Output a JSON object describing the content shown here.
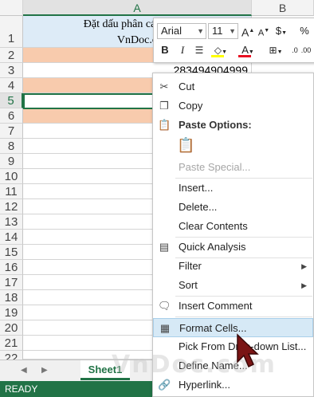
{
  "columns": {
    "a": "A",
    "b": "B"
  },
  "rows": [
    "1",
    "2",
    "3",
    "4",
    "5",
    "6",
    "7",
    "8",
    "9",
    "10",
    "11",
    "12",
    "13",
    "14",
    "15",
    "16",
    "17",
    "18",
    "19",
    "20",
    "21",
    "22"
  ],
  "cells": {
    "a1_line1": "Đặt dấu phân cách hàng",
    "a1_line2": "VnDoc.c",
    "a3_value": "283494904999"
  },
  "mini_toolbar": {
    "font_name": "Arial",
    "font_size": "11",
    "grow_font": "A",
    "shrink_font": "A",
    "currency": "$",
    "percent": "%",
    "bold": "B",
    "italic": "I",
    "font_color_letter": "A"
  },
  "context_menu": {
    "cut": "Cut",
    "copy": "Copy",
    "paste_options": "Paste Options:",
    "paste_special": "Paste Special...",
    "insert": "Insert...",
    "delete": "Delete...",
    "clear_contents": "Clear Contents",
    "quick_analysis": "Quick Analysis",
    "filter": "Filter",
    "sort": "Sort",
    "insert_comment": "Insert Comment",
    "format_cells": "Format Cells...",
    "pick_from_dropdown": "Pick From Drop-down List...",
    "define_name": "Define Name...",
    "hyperlink": "Hyperlink..."
  },
  "tabs": {
    "sheet1": "Sheet1"
  },
  "status": {
    "ready": "READY"
  },
  "watermark": "VnDoc.com",
  "colors": {
    "accent": "#217346",
    "highlight_fill": "#f8cbad",
    "header_fill": "#ddebf7",
    "font_color_bar": "#e81123"
  }
}
